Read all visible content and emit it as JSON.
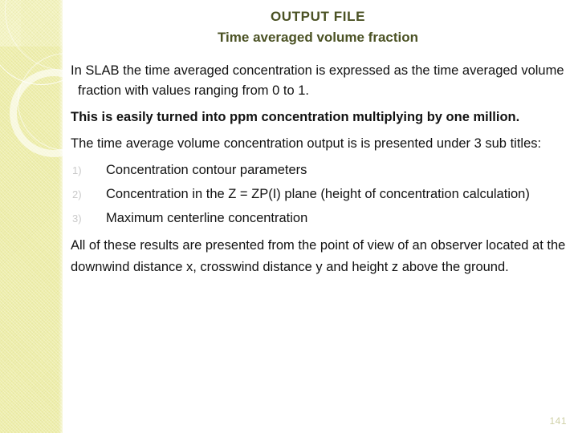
{
  "slide": {
    "background_color": "#ffffff",
    "accent_color": "#4b5224",
    "sidebar_color": "#eeeeab",
    "number": "141"
  },
  "title": {
    "line1": "OUTPUT FILE",
    "line2": "Time averaged volume fraction"
  },
  "body": {
    "paragraph1": "In SLAB the time averaged concentration is expressed as the time averaged volume fraction with values ranging from 0 to 1.",
    "paragraph2_bold": "This is easily turned into ppm concentration multiplying by one million.",
    "paragraph3": "The time average volume concentration output is is presented under 3 sub titles:",
    "list": [
      {
        "marker": "1)",
        "text": "Concentration contour parameters"
      },
      {
        "marker": "2)",
        "text": "Concentration in the Z = ZP(I) plane (height of concentration calculation)"
      },
      {
        "marker": "3)",
        "text": "Maximum centerline concentration"
      }
    ],
    "paragraph4": "All of these results are presented from the point of view of an observer located at the downwind distance x, crosswind distance y and height z above the ground."
  }
}
